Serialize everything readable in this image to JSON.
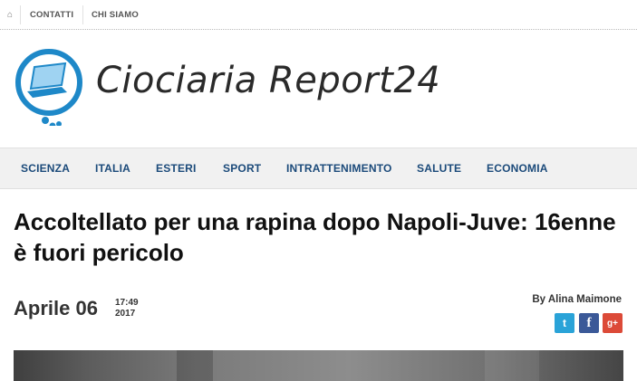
{
  "topbar": {
    "home_icon": "⌂",
    "links": [
      "CONTATTI",
      "CHI SIAMO"
    ]
  },
  "header": {
    "logo_text": "Ciociaria Report24",
    "logo_icon": "laptop-bubble-icon",
    "colors": {
      "logo_blue": "#1e88c8",
      "logo_text": "#2a2a2a"
    }
  },
  "nav": {
    "items": [
      "SCIENZA",
      "ITALIA",
      "ESTERI",
      "SPORT",
      "INTRATTENIMENTO",
      "SALUTE",
      "ECONOMIA"
    ],
    "color": "#1b4a7a"
  },
  "article": {
    "headline": "Accoltellato per una rapina dopo Napoli-Juve: 16enne è fuori pericolo",
    "date": "Aprile 06",
    "time": "17:49",
    "year": "2017",
    "byline": "By Alina Maimone",
    "social": {
      "twitter": "t",
      "facebook": "f",
      "google_plus": "g+"
    }
  }
}
